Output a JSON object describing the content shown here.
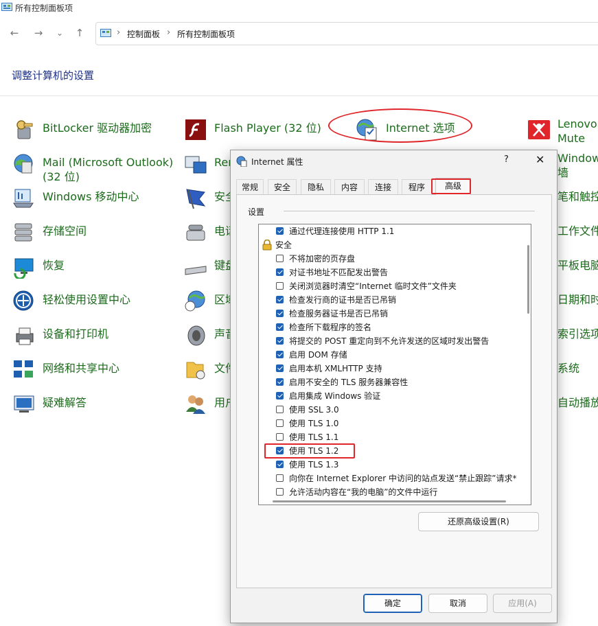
{
  "window": {
    "title": "所有控制面板项"
  },
  "breadcrumb": {
    "items": [
      "控制面板",
      "所有控制面板项"
    ],
    "sep": "›"
  },
  "nav": {
    "back": "←",
    "forward": "→",
    "recent": "⌄",
    "up": "↑"
  },
  "heading": "调整计算机的设置",
  "items": {
    "bitlocker": "BitLocker 驱动器加密",
    "flash": "Flash Player (32 位)",
    "internet": "Internet 选项",
    "lenovo_l1": "Lenovo",
    "lenovo_l2": "Mute",
    "mail_l1": "Mail (Microsoft Outlook)",
    "mail_l2": "(32 位)",
    "remote": "Rer",
    "windows_l1": "Window",
    "windows_l2": "墙",
    "mobility": "Windows 移动中心",
    "security": "安全",
    "pen": "笔和触控",
    "storage": "存储空间",
    "phone": "电话",
    "workfolders": "工作文件",
    "recovery": "恢复",
    "keyboard": "键盘",
    "tablet": "平板电脑",
    "ease": "轻松使用设置中心",
    "region": "区域",
    "datetime": "日期和时",
    "devices": "设备和打印机",
    "sound": "声音",
    "indexing": "索引选项",
    "network": "网络和共享中心",
    "fileexplorer": "文件",
    "system": "系统",
    "troubleshoot": "疑难解答",
    "users": "用户",
    "autoplay": "自动播放"
  },
  "dialog": {
    "title": "Internet 属性",
    "help": "?",
    "close": "✕",
    "tabs": [
      "常规",
      "安全",
      "隐私",
      "内容",
      "连接",
      "程序",
      "高级"
    ],
    "active_tab": "高级",
    "group": "设置",
    "rows": [
      {
        "text": "通过代理连接使用 HTTP 1.1",
        "checked": true
      },
      {
        "text": "安全",
        "header": true
      },
      {
        "text": "不将加密的页存盘",
        "checked": false
      },
      {
        "text": "对证书地址不匹配发出警告",
        "checked": true
      },
      {
        "text": "关闭浏览器时清空“Internet 临时文件”文件夹",
        "checked": false
      },
      {
        "text": "检查发行商的证书是否已吊销",
        "checked": true
      },
      {
        "text": "检查服务器证书是否已吊销",
        "checked": true
      },
      {
        "text": "检查所下载程序的签名",
        "checked": true
      },
      {
        "text": "将提交的 POST 重定向到不允许发送的区域时发出警告",
        "checked": true
      },
      {
        "text": "启用 DOM 存储",
        "checked": true
      },
      {
        "text": "启用本机 XMLHTTP 支持",
        "checked": true
      },
      {
        "text": "启用不安全的 TLS 服务器兼容性",
        "checked": true
      },
      {
        "text": "启用集成 Windows 验证",
        "checked": true
      },
      {
        "text": "使用 SSL 3.0",
        "checked": false
      },
      {
        "text": "使用 TLS 1.0",
        "checked": false
      },
      {
        "text": "使用 TLS 1.1",
        "checked": false
      },
      {
        "text": "使用 TLS 1.2",
        "checked": true
      },
      {
        "text": "使用 TLS 1.3",
        "checked": true
      },
      {
        "text": "向你在 Internet Explorer 中访问的站点发送“禁止跟踪”请求*",
        "checked": false
      },
      {
        "text": "允许活动内容在“我的电脑”的文件中运行",
        "checked": false
      }
    ],
    "restore_label": "还原高级设置(R)",
    "ok_label": "确定",
    "cancel_label": "取消",
    "apply_label": "应用(A)"
  },
  "colors": {
    "link": "#1b6b1b",
    "heading": "#1e3287",
    "accent": "#1f62b5",
    "annotation": "#e0262b"
  }
}
